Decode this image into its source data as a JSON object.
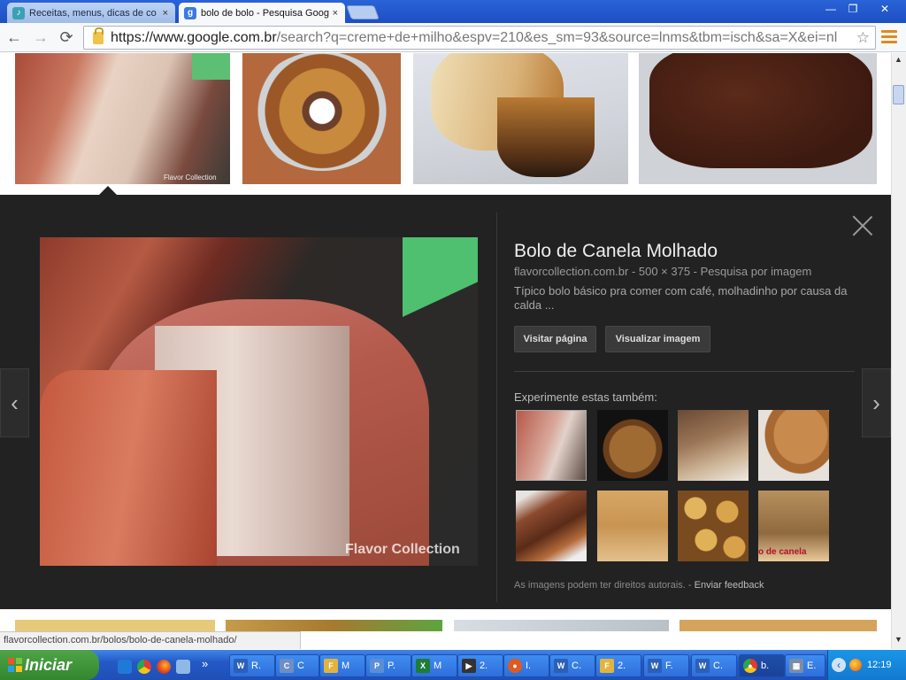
{
  "browser": {
    "tabs": [
      {
        "label": "Receitas, menus, dicas de co",
        "close": "×"
      },
      {
        "label": "bolo de bolo - Pesquisa Goog",
        "close": "×"
      }
    ],
    "window_buttons": {
      "minimize": "—",
      "maximize": "❐",
      "close": "✕"
    },
    "back": "←",
    "forward": "→",
    "reload": "⟳",
    "url_host": "https://www.google.com.br",
    "url_rest": "/search?q=creme+de+milho&espv=210&es_sm=93&source=lnms&tbm=isch&sa=X&ei=nl",
    "star": "☆"
  },
  "preview": {
    "title": "Bolo de Canela Molhado",
    "meta": "flavorcollection.com.br - 500 × 375 - Pesquisa por imagem",
    "description": "Típico bolo básico pra comer com café, molhadinho por causa da calda ...",
    "visit_button": "Visitar página",
    "view_button": "Visualizar imagem",
    "also_title": "Experimente estas também:",
    "copyright_notice": "As imagens podem ter direitos autorais.",
    "notice_sep": " - ",
    "feedback_link": "Enviar feedback",
    "watermark": "Flavor Collection",
    "prev_arrow": "‹",
    "next_arrow": "›"
  },
  "status_url": "flavorcollection.com.br/bolos/bolo-de-canela-molhado/",
  "thumb_watermark": "Flavor Collection",
  "related_caption": "o de canela",
  "taskbar": {
    "start": "Iniciar",
    "chevron": "»",
    "buttons": [
      {
        "icon": "W",
        "label": "R."
      },
      {
        "icon": "C",
        "label": "C"
      },
      {
        "icon": "F",
        "label": "M"
      },
      {
        "icon": "P",
        "label": "P."
      },
      {
        "icon": "X",
        "label": "M"
      },
      {
        "icon": "▶",
        "label": "2."
      },
      {
        "icon": "●",
        "label": "I."
      },
      {
        "icon": "W",
        "label": "C."
      },
      {
        "icon": "F",
        "label": "2."
      },
      {
        "icon": "W",
        "label": "F."
      },
      {
        "icon": "W",
        "label": "C."
      },
      {
        "icon": "●",
        "label": "b."
      },
      {
        "icon": "▦",
        "label": "E."
      }
    ],
    "clock": "12:19"
  }
}
